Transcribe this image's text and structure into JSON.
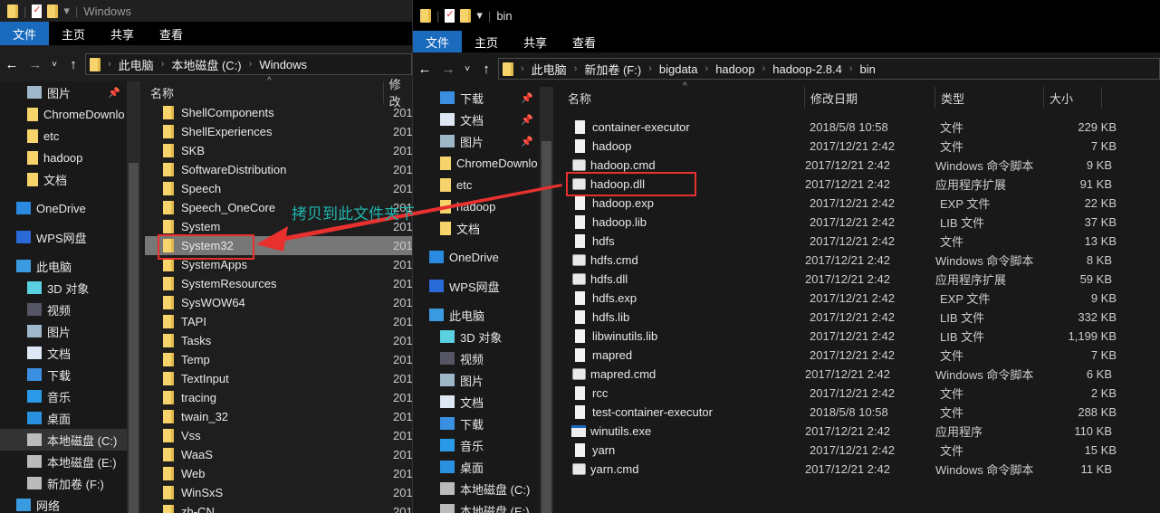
{
  "left": {
    "title": "Windows",
    "ribbon": [
      "文件",
      "主页",
      "共享",
      "查看"
    ],
    "breadcrumb": [
      "此电脑",
      "本地磁盘 (C:)",
      "Windows"
    ],
    "nav": [
      {
        "label": "图片",
        "icon": "pictures-icon",
        "pin": true
      },
      {
        "label": "ChromeDownlo",
        "icon": "folder-icon"
      },
      {
        "label": "etc",
        "icon": "folder-icon"
      },
      {
        "label": "hadoop",
        "icon": "folder-icon"
      },
      {
        "label": "文档",
        "icon": "folder-icon"
      },
      {
        "label": "",
        "icon": ""
      },
      {
        "label": "OneDrive",
        "icon": "onedrive-icon",
        "top": true
      },
      {
        "label": "",
        "icon": ""
      },
      {
        "label": "WPS网盘",
        "icon": "cloud-icon",
        "top": true
      },
      {
        "label": "",
        "icon": ""
      },
      {
        "label": "此电脑",
        "icon": "computer-icon",
        "top": true
      },
      {
        "label": "3D 对象",
        "icon": "3d-objects-icon"
      },
      {
        "label": "视频",
        "icon": "video-icon"
      },
      {
        "label": "图片",
        "icon": "pictures-icon"
      },
      {
        "label": "文档",
        "icon": "documents-icon"
      },
      {
        "label": "下载",
        "icon": "download-icon"
      },
      {
        "label": "音乐",
        "icon": "music-icon"
      },
      {
        "label": "桌面",
        "icon": "desktop-icon"
      },
      {
        "label": "本地磁盘 (C:)",
        "icon": "drive-icon",
        "selected": true
      },
      {
        "label": "本地磁盘 (E:)",
        "icon": "drive-icon"
      },
      {
        "label": "新加卷 (F:)",
        "icon": "drive-icon"
      },
      {
        "label": "网络",
        "icon": "network-icon",
        "top": true
      }
    ],
    "headers": [
      "名称",
      "修改"
    ],
    "files": [
      "ShellComponents",
      "ShellExperiences",
      "SKB",
      "SoftwareDistribution",
      "Speech",
      "Speech_OneCore",
      "System",
      "System32",
      "SystemApps",
      "SystemResources",
      "SysWOW64",
      "TAPI",
      "Tasks",
      "Temp",
      "TextInput",
      "tracing",
      "twain_32",
      "Vss",
      "WaaS",
      "Web",
      "WinSxS",
      "zh-CN"
    ],
    "date_prefix": "201",
    "highlighted": "System32"
  },
  "right": {
    "title": "bin",
    "ribbon": [
      "文件",
      "主页",
      "共享",
      "查看"
    ],
    "breadcrumb": [
      "此电脑",
      "新加卷 (F:)",
      "bigdata",
      "hadoop",
      "hadoop-2.8.4",
      "bin"
    ],
    "nav": [
      {
        "label": "下载",
        "icon": "download-icon",
        "pin": true
      },
      {
        "label": "文档",
        "icon": "documents-icon",
        "pin": true
      },
      {
        "label": "图片",
        "icon": "pictures-icon",
        "pin": true
      },
      {
        "label": "ChromeDownlo",
        "icon": "folder-icon"
      },
      {
        "label": "etc",
        "icon": "folder-icon"
      },
      {
        "label": "hadoop",
        "icon": "folder-icon"
      },
      {
        "label": "文档",
        "icon": "folder-icon"
      },
      {
        "label": "",
        "icon": ""
      },
      {
        "label": "OneDrive",
        "icon": "onedrive-icon",
        "top": true
      },
      {
        "label": "",
        "icon": ""
      },
      {
        "label": "WPS网盘",
        "icon": "cloud-icon",
        "top": true
      },
      {
        "label": "",
        "icon": ""
      },
      {
        "label": "此电脑",
        "icon": "computer-icon",
        "top": true
      },
      {
        "label": "3D 对象",
        "icon": "3d-objects-icon"
      },
      {
        "label": "视频",
        "icon": "video-icon"
      },
      {
        "label": "图片",
        "icon": "pictures-icon"
      },
      {
        "label": "文档",
        "icon": "documents-icon"
      },
      {
        "label": "下载",
        "icon": "download-icon"
      },
      {
        "label": "音乐",
        "icon": "music-icon"
      },
      {
        "label": "桌面",
        "icon": "desktop-icon"
      },
      {
        "label": "本地磁盘 (C:)",
        "icon": "drive-icon"
      },
      {
        "label": "本地磁盘 (E:)",
        "icon": "drive-icon"
      }
    ],
    "headers": [
      "名称",
      "修改日期",
      "类型",
      "大小"
    ],
    "files": [
      {
        "name": "container-executor",
        "date": "2018/5/8 10:58",
        "type": "文件",
        "size": "229 KB",
        "icon": "doc"
      },
      {
        "name": "hadoop",
        "date": "2017/12/21 2:42",
        "type": "文件",
        "size": "7 KB",
        "icon": "doc"
      },
      {
        "name": "hadoop.cmd",
        "date": "2017/12/21 2:42",
        "type": "Windows 命令脚本",
        "size": "9 KB",
        "icon": "gear"
      },
      {
        "name": "hadoop.dll",
        "date": "2017/12/21 2:42",
        "type": "应用程序扩展",
        "size": "91 KB",
        "icon": "gear"
      },
      {
        "name": "hadoop.exp",
        "date": "2017/12/21 2:42",
        "type": "EXP 文件",
        "size": "22 KB",
        "icon": "doc"
      },
      {
        "name": "hadoop.lib",
        "date": "2017/12/21 2:42",
        "type": "LIB 文件",
        "size": "37 KB",
        "icon": "doc"
      },
      {
        "name": "hdfs",
        "date": "2017/12/21 2:42",
        "type": "文件",
        "size": "13 KB",
        "icon": "doc"
      },
      {
        "name": "hdfs.cmd",
        "date": "2017/12/21 2:42",
        "type": "Windows 命令脚本",
        "size": "8 KB",
        "icon": "gear"
      },
      {
        "name": "hdfs.dll",
        "date": "2017/12/21 2:42",
        "type": "应用程序扩展",
        "size": "59 KB",
        "icon": "gear"
      },
      {
        "name": "hdfs.exp",
        "date": "2017/12/21 2:42",
        "type": "EXP 文件",
        "size": "9 KB",
        "icon": "doc"
      },
      {
        "name": "hdfs.lib",
        "date": "2017/12/21 2:42",
        "type": "LIB 文件",
        "size": "332 KB",
        "icon": "doc"
      },
      {
        "name": "libwinutils.lib",
        "date": "2017/12/21 2:42",
        "type": "LIB 文件",
        "size": "1,199 KB",
        "icon": "doc"
      },
      {
        "name": "mapred",
        "date": "2017/12/21 2:42",
        "type": "文件",
        "size": "7 KB",
        "icon": "doc"
      },
      {
        "name": "mapred.cmd",
        "date": "2017/12/21 2:42",
        "type": "Windows 命令脚本",
        "size": "6 KB",
        "icon": "gear"
      },
      {
        "name": "rcc",
        "date": "2017/12/21 2:42",
        "type": "文件",
        "size": "2 KB",
        "icon": "doc"
      },
      {
        "name": "test-container-executor",
        "date": "2018/5/8 10:58",
        "type": "文件",
        "size": "288 KB",
        "icon": "doc"
      },
      {
        "name": "winutils.exe",
        "date": "2017/12/21 2:42",
        "type": "应用程序",
        "size": "110 KB",
        "icon": "exe"
      },
      {
        "name": "yarn",
        "date": "2017/12/21 2:42",
        "type": "文件",
        "size": "15 KB",
        "icon": "doc"
      },
      {
        "name": "yarn.cmd",
        "date": "2017/12/21 2:42",
        "type": "Windows 命令脚本",
        "size": "11 KB",
        "icon": "gear"
      }
    ],
    "highlighted": "hadoop.dll"
  },
  "annotation": "拷贝到此文件夹下",
  "colors": {
    "accent": "#1a6bbd",
    "annotation": "#1fb5ae",
    "arrow": "#e8312f"
  }
}
